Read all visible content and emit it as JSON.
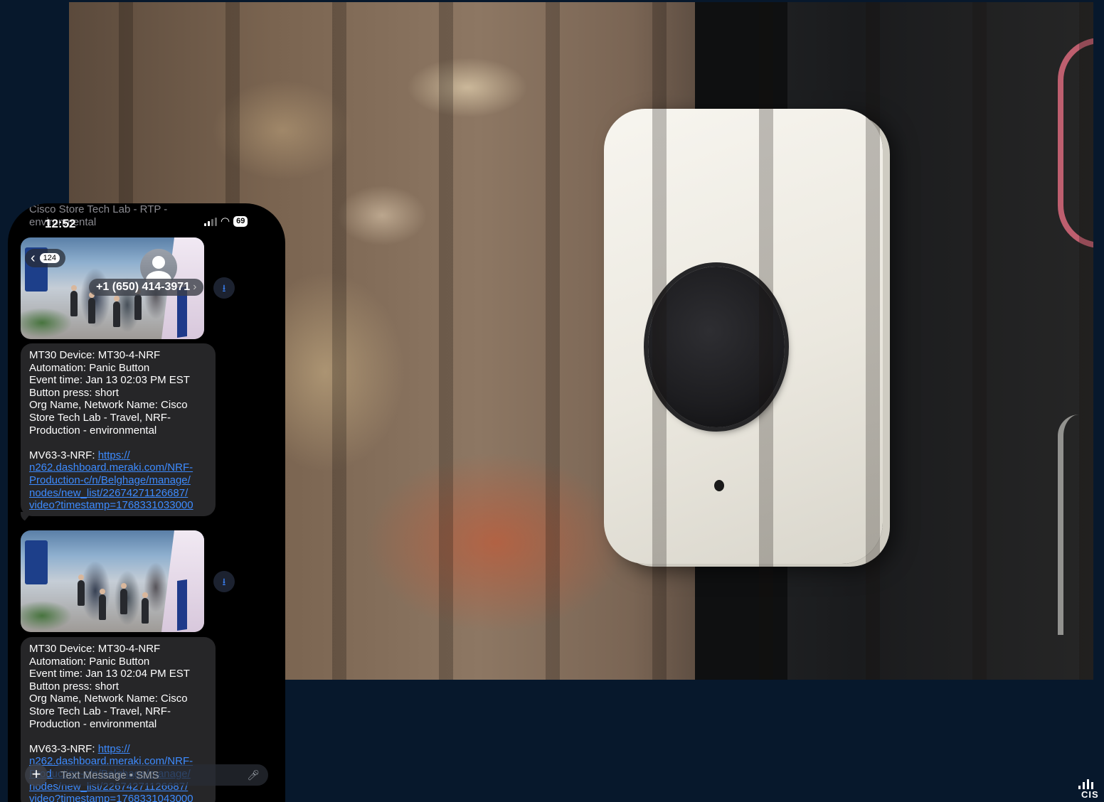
{
  "phone": {
    "faded_header_line1": "Cisco Store Tech Lab - RTP -",
    "faded_header_line2": "environmental",
    "status": {
      "time": "12:52",
      "battery": "69"
    },
    "header": {
      "unread_count": "124",
      "contact": "+1 (650) 414-3971"
    },
    "messages": [
      {
        "lines": "MT30 Device: MT30-4-NRF\nAutomation: Panic Button\nEvent time: Jan 13 02:03 PM EST\nButton press: short\nOrg Name, Network Name: Cisco\nStore Tech Lab -  Travel, NRF-\nProduction - environmental",
        "link_prefix": "MV63-3-NRF: ",
        "link_text": "https://\nn262.dashboard.meraki.com/NRF-\nProduction-c/n/Belghage/manage/\nnodes/new_list/22674271126687/\nvideo?timestamp=1768331033000"
      },
      {
        "lines": "MT30 Device: MT30-4-NRF\nAutomation: Panic Button\nEvent time: Jan 13 02:04 PM EST\nButton press: short\nOrg Name, Network Name: Cisco\nStore Tech Lab -  Travel, NRF-\nProduction - environmental",
        "link_prefix": "MV63-3-NRF: ",
        "link_text": "https://\nn262.dashboard.meraki.com/NRF-\nProduction-c/n/Belghage/manage/\nnodes/new_list/22674271126687/\nvideo?timestamp=1768331043000"
      }
    ],
    "input": {
      "placeholder": "Text Message • SMS",
      "plus": "+"
    }
  },
  "icons": {
    "back": "chevron-left-icon",
    "save": "save-to-photos-icon",
    "mic": "microphone-icon",
    "wifi": "wifi-icon",
    "signal": "signal-icon"
  },
  "colors": {
    "background": "#07182c",
    "link": "#3d8bff",
    "bubble": "#262628"
  },
  "brand": {
    "logo_text": "CIS"
  }
}
